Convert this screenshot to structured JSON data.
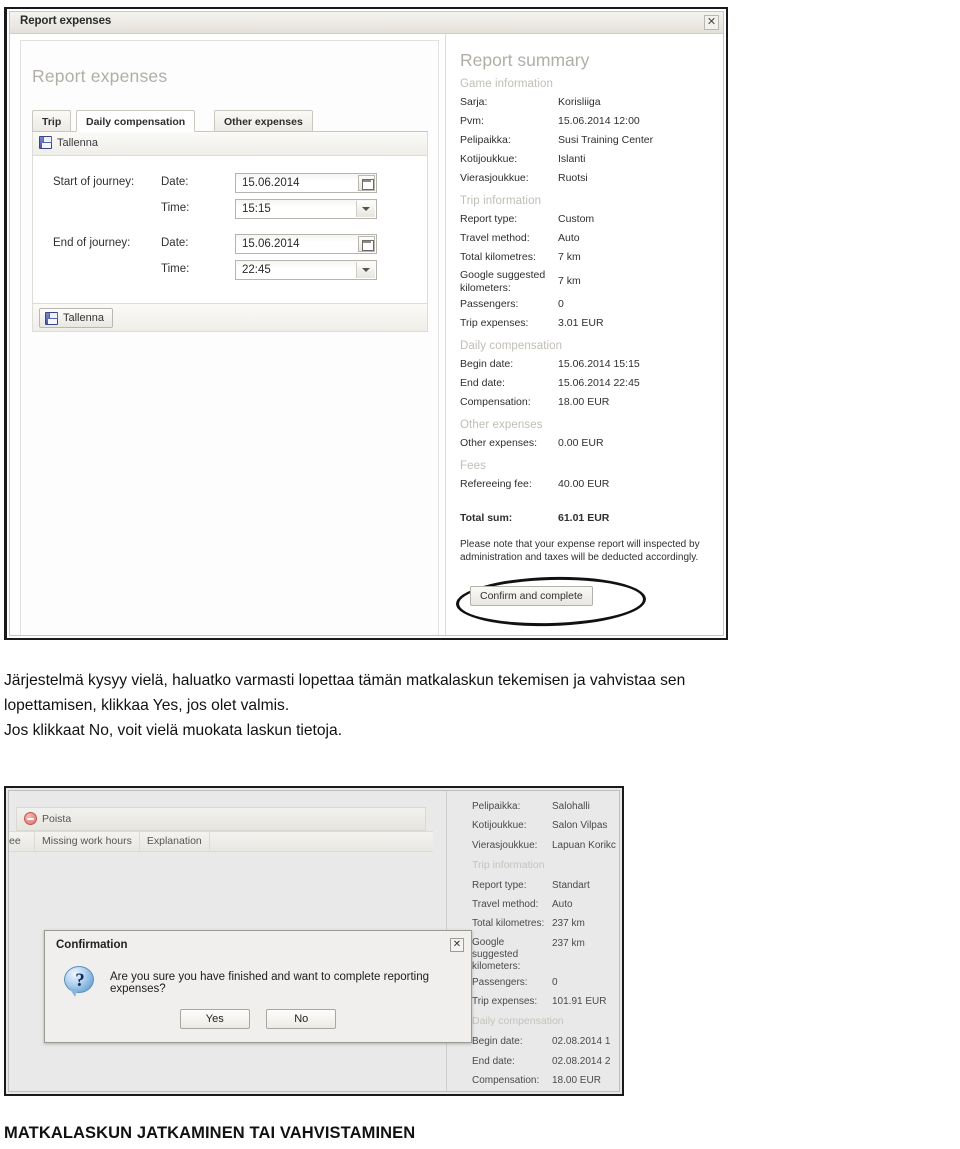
{
  "screenshot1": {
    "window_title": "Report expenses",
    "close_icon": "close-icon",
    "left": {
      "heading": "Report expenses",
      "tabs": [
        {
          "label": "Trip",
          "active": false
        },
        {
          "label": "Daily compensation",
          "active": true
        },
        {
          "label": "Other expenses",
          "active": false
        }
      ],
      "toolbar_save_label": "Tallenna",
      "bottom_save_label": "Tallenna",
      "rows": [
        {
          "group": "Start of journey:",
          "date_label": "Date:",
          "date_value": "15.06.2014",
          "time_label": "Time:",
          "time_value": "15:15"
        },
        {
          "group": "End of journey:",
          "date_label": "Date:",
          "date_value": "15.06.2014",
          "time_label": "Time:",
          "time_value": "22:45"
        }
      ]
    },
    "summary": {
      "title": "Report summary",
      "sections": [
        {
          "heading": "Game information",
          "rows": [
            {
              "key": "Sarja:",
              "value": "Korisliiga"
            },
            {
              "key": "Pvm:",
              "value": "15.06.2014 12:00"
            },
            {
              "key": "Pelipaikka:",
              "value": "Susi Training Center"
            },
            {
              "key": "Kotijoukkue:",
              "value": "Islanti"
            },
            {
              "key": "Vierasjoukkue:",
              "value": "Ruotsi"
            }
          ]
        },
        {
          "heading": "Trip information",
          "rows": [
            {
              "key": "Report type:",
              "value": "Custom"
            },
            {
              "key": "Travel method:",
              "value": "Auto"
            },
            {
              "key": "Total kilometres:",
              "value": "7 km"
            },
            {
              "key": "Google suggested kilometers:",
              "value": "7 km",
              "multiline": true
            },
            {
              "key": "Passengers:",
              "value": "0"
            },
            {
              "key": "Trip expenses:",
              "value": "3.01 EUR"
            }
          ]
        },
        {
          "heading": "Daily compensation",
          "rows": [
            {
              "key": "Begin date:",
              "value": "15.06.2014 15:15"
            },
            {
              "key": "End date:",
              "value": "15.06.2014 22:45"
            },
            {
              "key": "Compensation:",
              "value": "18.00 EUR"
            }
          ]
        },
        {
          "heading": "Other expenses",
          "rows": [
            {
              "key": "Other expenses:",
              "value": "0.00 EUR"
            }
          ]
        },
        {
          "heading": "Fees",
          "rows": [
            {
              "key": "Refereeing fee:",
              "value": "40.00 EUR"
            }
          ]
        }
      ],
      "total_key": "Total sum:",
      "total_value": "61.01 EUR",
      "note": "Please note that your expense report will inspected by administration and taxes will be deducted accordingly.",
      "confirm_button": "Confirm and complete"
    }
  },
  "caption": {
    "line1": "Järjestelmä kysyy vielä, haluatko varmasti lopettaa tämän matkalaskun tekemisen ja vahvistaa sen",
    "line2": "lopettamisen, klikkaa Yes, jos olet valmis.",
    "line3": "Jos klikkaat No, voit vielä muokata laskun tietoja."
  },
  "screenshot2": {
    "toolbar_delete_label": "Poista",
    "grid_columns": [
      "ee",
      "Missing work hours",
      "Explanation"
    ],
    "summary_rows": [
      {
        "key": "Pelipaikka:",
        "value": "Salohalli"
      },
      {
        "key": "Kotijoukkue:",
        "value": "Salon Vilpas"
      },
      {
        "key": "Vierasjoukkue:",
        "value": "Lapuan Korikc"
      }
    ],
    "trip_heading": "Trip information",
    "trip_rows": [
      {
        "key": "Report type:",
        "value": "Standart"
      },
      {
        "key": "Travel method:",
        "value": "Auto"
      },
      {
        "key": "Total kilometres:",
        "value": "237 km"
      },
      {
        "key": "Google suggested kilometers:",
        "value": "237 km",
        "multiline": true
      },
      {
        "key": "Passengers:",
        "value": "0"
      },
      {
        "key": "Trip expenses:",
        "value": "101.91 EUR"
      }
    ],
    "daily_heading": "Daily compensation",
    "daily_rows": [
      {
        "key": "Begin date:",
        "value": "02.08.2014 1"
      },
      {
        "key": "End date:",
        "value": "02.08.2014 2"
      },
      {
        "key": "Compensation:",
        "value": "18.00 EUR"
      }
    ],
    "dialog": {
      "title": "Confirmation",
      "close_icon": "close-icon",
      "icon": "question-icon",
      "icon_glyph": "?",
      "message": "Are you sure you have finished and want to complete reporting expenses?",
      "yes_label": "Yes",
      "no_label": "No"
    }
  },
  "bottom_heading": "MATKALASKUN JATKAMINEN TAI VAHVISTAMINEN"
}
